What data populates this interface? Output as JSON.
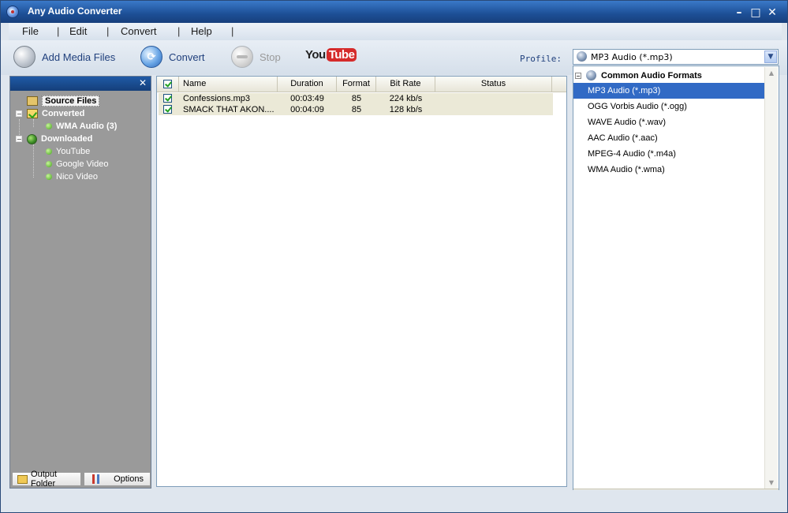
{
  "window": {
    "title": "Any Audio Converter"
  },
  "menu": [
    "File",
    "Edit",
    "Convert",
    "Help"
  ],
  "toolbar": {
    "add_label": "Add Media Files",
    "convert_label": "Convert",
    "stop_label": "Stop",
    "youtube_you": "You",
    "youtube_tube": "Tube",
    "profile_label": "Profile:",
    "profile_value": "MP3 Audio (*.mp3)"
  },
  "tree": {
    "source": "Source Files",
    "converted": "Converted",
    "converted_child": "WMA Audio (3)",
    "downloaded": "Downloaded",
    "downloaded_children": [
      "YouTube",
      "Google Video",
      "Nico Video"
    ]
  },
  "left_footer": {
    "output": "Output Folder",
    "options": "Options"
  },
  "file_table": {
    "columns": [
      "Name",
      "Duration",
      "Format",
      "Bit Rate",
      "Status"
    ],
    "rows": [
      {
        "name": "Confessions.mp3",
        "duration": "00:03:49",
        "format": "85",
        "bitrate": "224 kb/s",
        "status": ""
      },
      {
        "name": "SMACK THAT AKON....",
        "duration": "00:04:09",
        "format": "85",
        "bitrate": "128 kb/s",
        "status": ""
      }
    ]
  },
  "profile_dropdown": {
    "group": "Common Audio Formats",
    "options": [
      "MP3 Audio (*.mp3)",
      "OGG Vorbis Audio (*.ogg)",
      "WAVE Audio (*.wav)",
      "AAC Audio (*.aac)",
      "MPEG-4 Audio (*.m4a)",
      "WMA Audio (*.wma)"
    ],
    "selected": "MP3 Audio (*.mp3)"
  },
  "colors": {
    "titlebar": "#1d4f96",
    "selection": "#316ac5",
    "left_panel": "#9a9a9a"
  }
}
